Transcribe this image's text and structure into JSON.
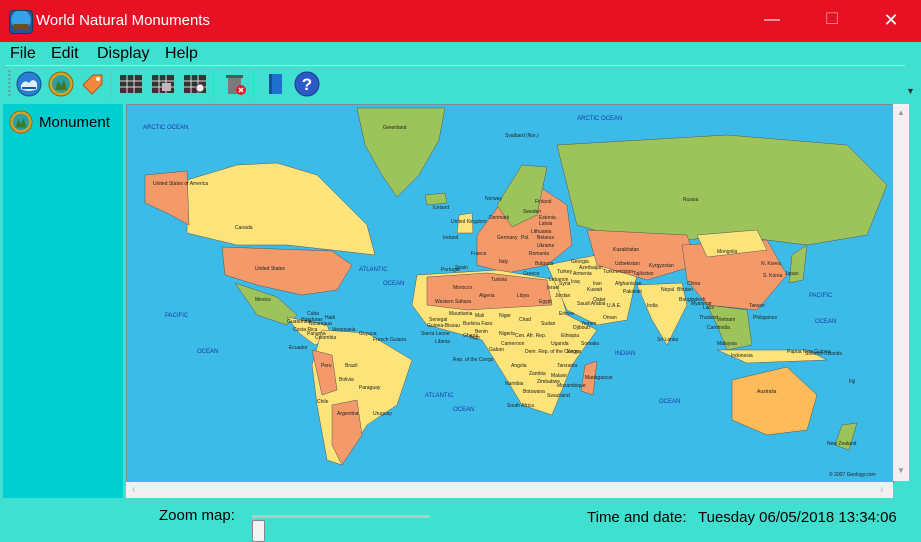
{
  "window": {
    "title": "World Natural Monuments",
    "min_symbol": "—",
    "max_symbol": "☐",
    "close_symbol": "✕"
  },
  "menu": [
    "File",
    "Edit",
    "Display",
    "Help"
  ],
  "toolbar": {
    "buttons": [
      {
        "icon": "globe-icon"
      },
      {
        "icon": "monument-icon"
      },
      {
        "icon": "tag-icon"
      },
      {
        "icon": "table-icon"
      },
      {
        "icon": "table-edit-icon"
      },
      {
        "icon": "table-search-icon"
      },
      {
        "icon": "delete-icon"
      },
      {
        "icon": "book-icon"
      },
      {
        "icon": "help-icon"
      }
    ]
  },
  "sidebar": {
    "items": [
      {
        "label": "Monument",
        "icon": "monument-icon"
      }
    ]
  },
  "map": {
    "oceans": [
      "ARCTIC OCEAN",
      "ARCTIC OCEAN",
      "PACIFIC",
      "OCEAN",
      "ATLANTIC",
      "OCEAN",
      "ATLANTIC",
      "OCEAN",
      "INDIAN",
      "OCEAN",
      "PACIFIC",
      "OCEAN"
    ],
    "labels": [
      "Greenland",
      "Svalbard (Nor.)",
      "Russia",
      "United States of America",
      "Canada",
      "United States",
      "Mexico",
      "Brazil",
      "Bolivia",
      "Chile",
      "Argentina",
      "Paraguay",
      "Uruguay",
      "Peru",
      "Colombia",
      "Venezuela",
      "Guyana",
      "French Guiana",
      "Ecuador",
      "Cuba",
      "Haiti",
      "Honduras",
      "Nicaragua",
      "Guatemala",
      "Costa Rica",
      "Panama",
      "Iceland",
      "Norway",
      "Sweden",
      "Finland",
      "United Kingdom",
      "Ireland",
      "Denmark",
      "Estonia",
      "Latvia",
      "Lithuania",
      "Pol.",
      "Belarus",
      "Ukraine",
      "Romania",
      "Bulgaria",
      "Turkey",
      "Portugal",
      "Spain",
      "France",
      "Italy",
      "Germany",
      "Greece",
      "Morocco",
      "Algeria",
      "Libya",
      "Egypt",
      "Western Sahara",
      "Mauritania",
      "Mali",
      "Niger",
      "Chad",
      "Sudan",
      "Nigeria",
      "Ethiopia",
      "Somalia",
      "Kenya",
      "Dem. Rep. of the Congo",
      "Rep. of the Congo",
      "Angola",
      "Zambia",
      "Namibia",
      "Botswana",
      "Zimbabwe",
      "Mozambique",
      "Madagascar",
      "South Africa",
      "Swaziland",
      "Senegal",
      "Guinea-Bissau",
      "Sierra Leone",
      "Liberia",
      "Ghana",
      "Kazakhstan",
      "Kyrgyzstan",
      "Uzbekistan",
      "Turkmenistan",
      "Afghanistan",
      "Pakistan",
      "Iran",
      "Iraq",
      "Syria",
      "Jordan",
      "Saudi Arabia",
      "Yemen",
      "Oman",
      "Kuwait",
      "Qatar",
      "U.A.E.",
      "India",
      "Nepal",
      "Bhutan",
      "Bangladesh",
      "Sri Lanka",
      "Myanmar",
      "Laos",
      "Thailand",
      "Cambodia",
      "Vietnam",
      "China",
      "Mongolia",
      "N. Korea",
      "S. Korea",
      "Japan",
      "Taiwan",
      "Philippines",
      "Malaysia",
      "Indonesia",
      "Papua New Guinea",
      "Solomon Islands",
      "Australia",
      "New Zealand",
      "Fiji",
      "Tajikistan",
      "Georgia",
      "Azerbaijan",
      "Armenia",
      "Djibouti",
      "Eritrea",
      "Malawi",
      "Tanzania",
      "Uganda",
      "Gabon",
      "Cameroon",
      "Cen. Afr. Rep.",
      "Burkina Faso",
      "Benin",
      "Togo",
      "Tunisia",
      "Israel",
      "Lebanon"
    ],
    "copyright": "© 2007 Geology.com"
  },
  "status": {
    "zoom_label": "Zoom map:",
    "zoom_value": 0,
    "datetime_label": "Time and date:",
    "datetime_value": "Tuesday 06/05/2018 13:34:06"
  },
  "colors": {
    "titlebar": "#E81123",
    "body": "#40E0D0",
    "sidebar": "#00CED1",
    "ocean": "#3DBBE8"
  }
}
